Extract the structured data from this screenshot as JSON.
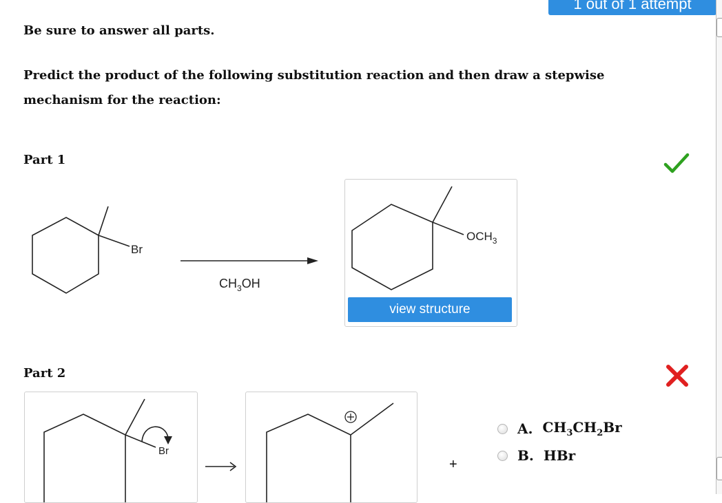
{
  "header": {
    "attempt_badge": "1 out of 1 attempt"
  },
  "instructions": "Be sure to answer all parts.",
  "question": "Predict the product of the following substitution reaction and then draw a stepwise mechanism for the reaction:",
  "part1": {
    "label": "Part 1",
    "status": "correct",
    "reactant_leaving_group": "Br",
    "reagent_text": "CH3OH",
    "product_group": "OCH3",
    "view_button": "view structure"
  },
  "part2": {
    "label": "Part 2",
    "status": "incorrect",
    "mech_leaving_group": "Br",
    "plus": "+",
    "choices": [
      {
        "letter": "A.",
        "formula": "CH3CH2Br"
      },
      {
        "letter": "B.",
        "formula": "HBr"
      }
    ]
  },
  "colors": {
    "accent": "#2f8ee0",
    "correct": "#2ea11f",
    "incorrect": "#e02020"
  },
  "icons": [
    "check-icon",
    "x-icon",
    "curved-arrow-icon",
    "reaction-arrow-icon"
  ]
}
